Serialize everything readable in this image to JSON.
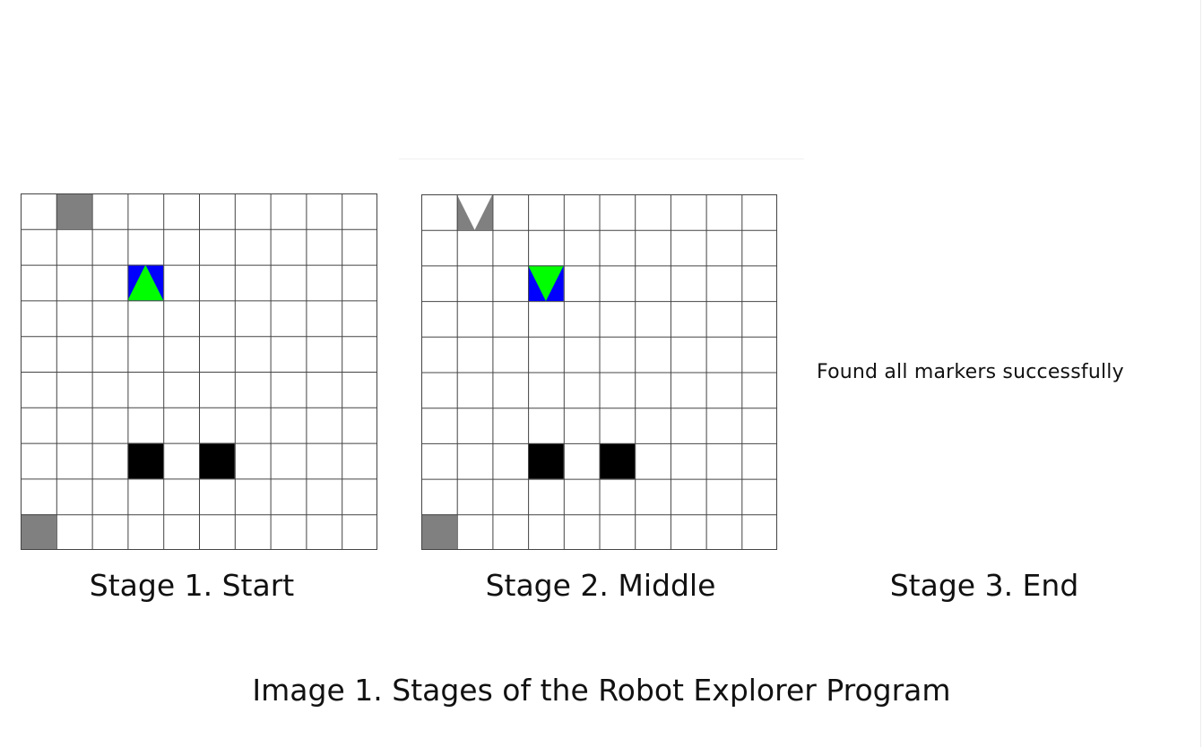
{
  "stages": [
    {
      "label": "Stage 1. Start",
      "grid": {
        "rows": 10,
        "cols": 10,
        "markers": [
          {
            "row": 0,
            "col": 1
          },
          {
            "row": 9,
            "col": 0
          }
        ],
        "obstacles": [
          {
            "row": 7,
            "col": 3
          },
          {
            "row": 7,
            "col": 5
          }
        ],
        "robot": {
          "row": 2,
          "col": 3,
          "direction": "up"
        }
      }
    },
    {
      "label": "Stage 2. Middle",
      "grid": {
        "rows": 10,
        "cols": 10,
        "markers": [
          {
            "row": 9,
            "col": 0
          }
        ],
        "marker_with_notch": [
          {
            "row": 0,
            "col": 1
          }
        ],
        "obstacles": [
          {
            "row": 7,
            "col": 3
          },
          {
            "row": 7,
            "col": 5
          }
        ],
        "robot": {
          "row": 2,
          "col": 3,
          "direction": "down"
        }
      }
    },
    {
      "label": "Stage 3. End",
      "message": "Found all markers successfully"
    }
  ],
  "caption": "Image 1. Stages of the Robot Explorer Program",
  "colors": {
    "grid_line": "#444444",
    "marker": "#808080",
    "obstacle": "#000000",
    "robot_background": "#0000ff",
    "robot_arrow": "#00ff00",
    "background": "#ffffff"
  }
}
